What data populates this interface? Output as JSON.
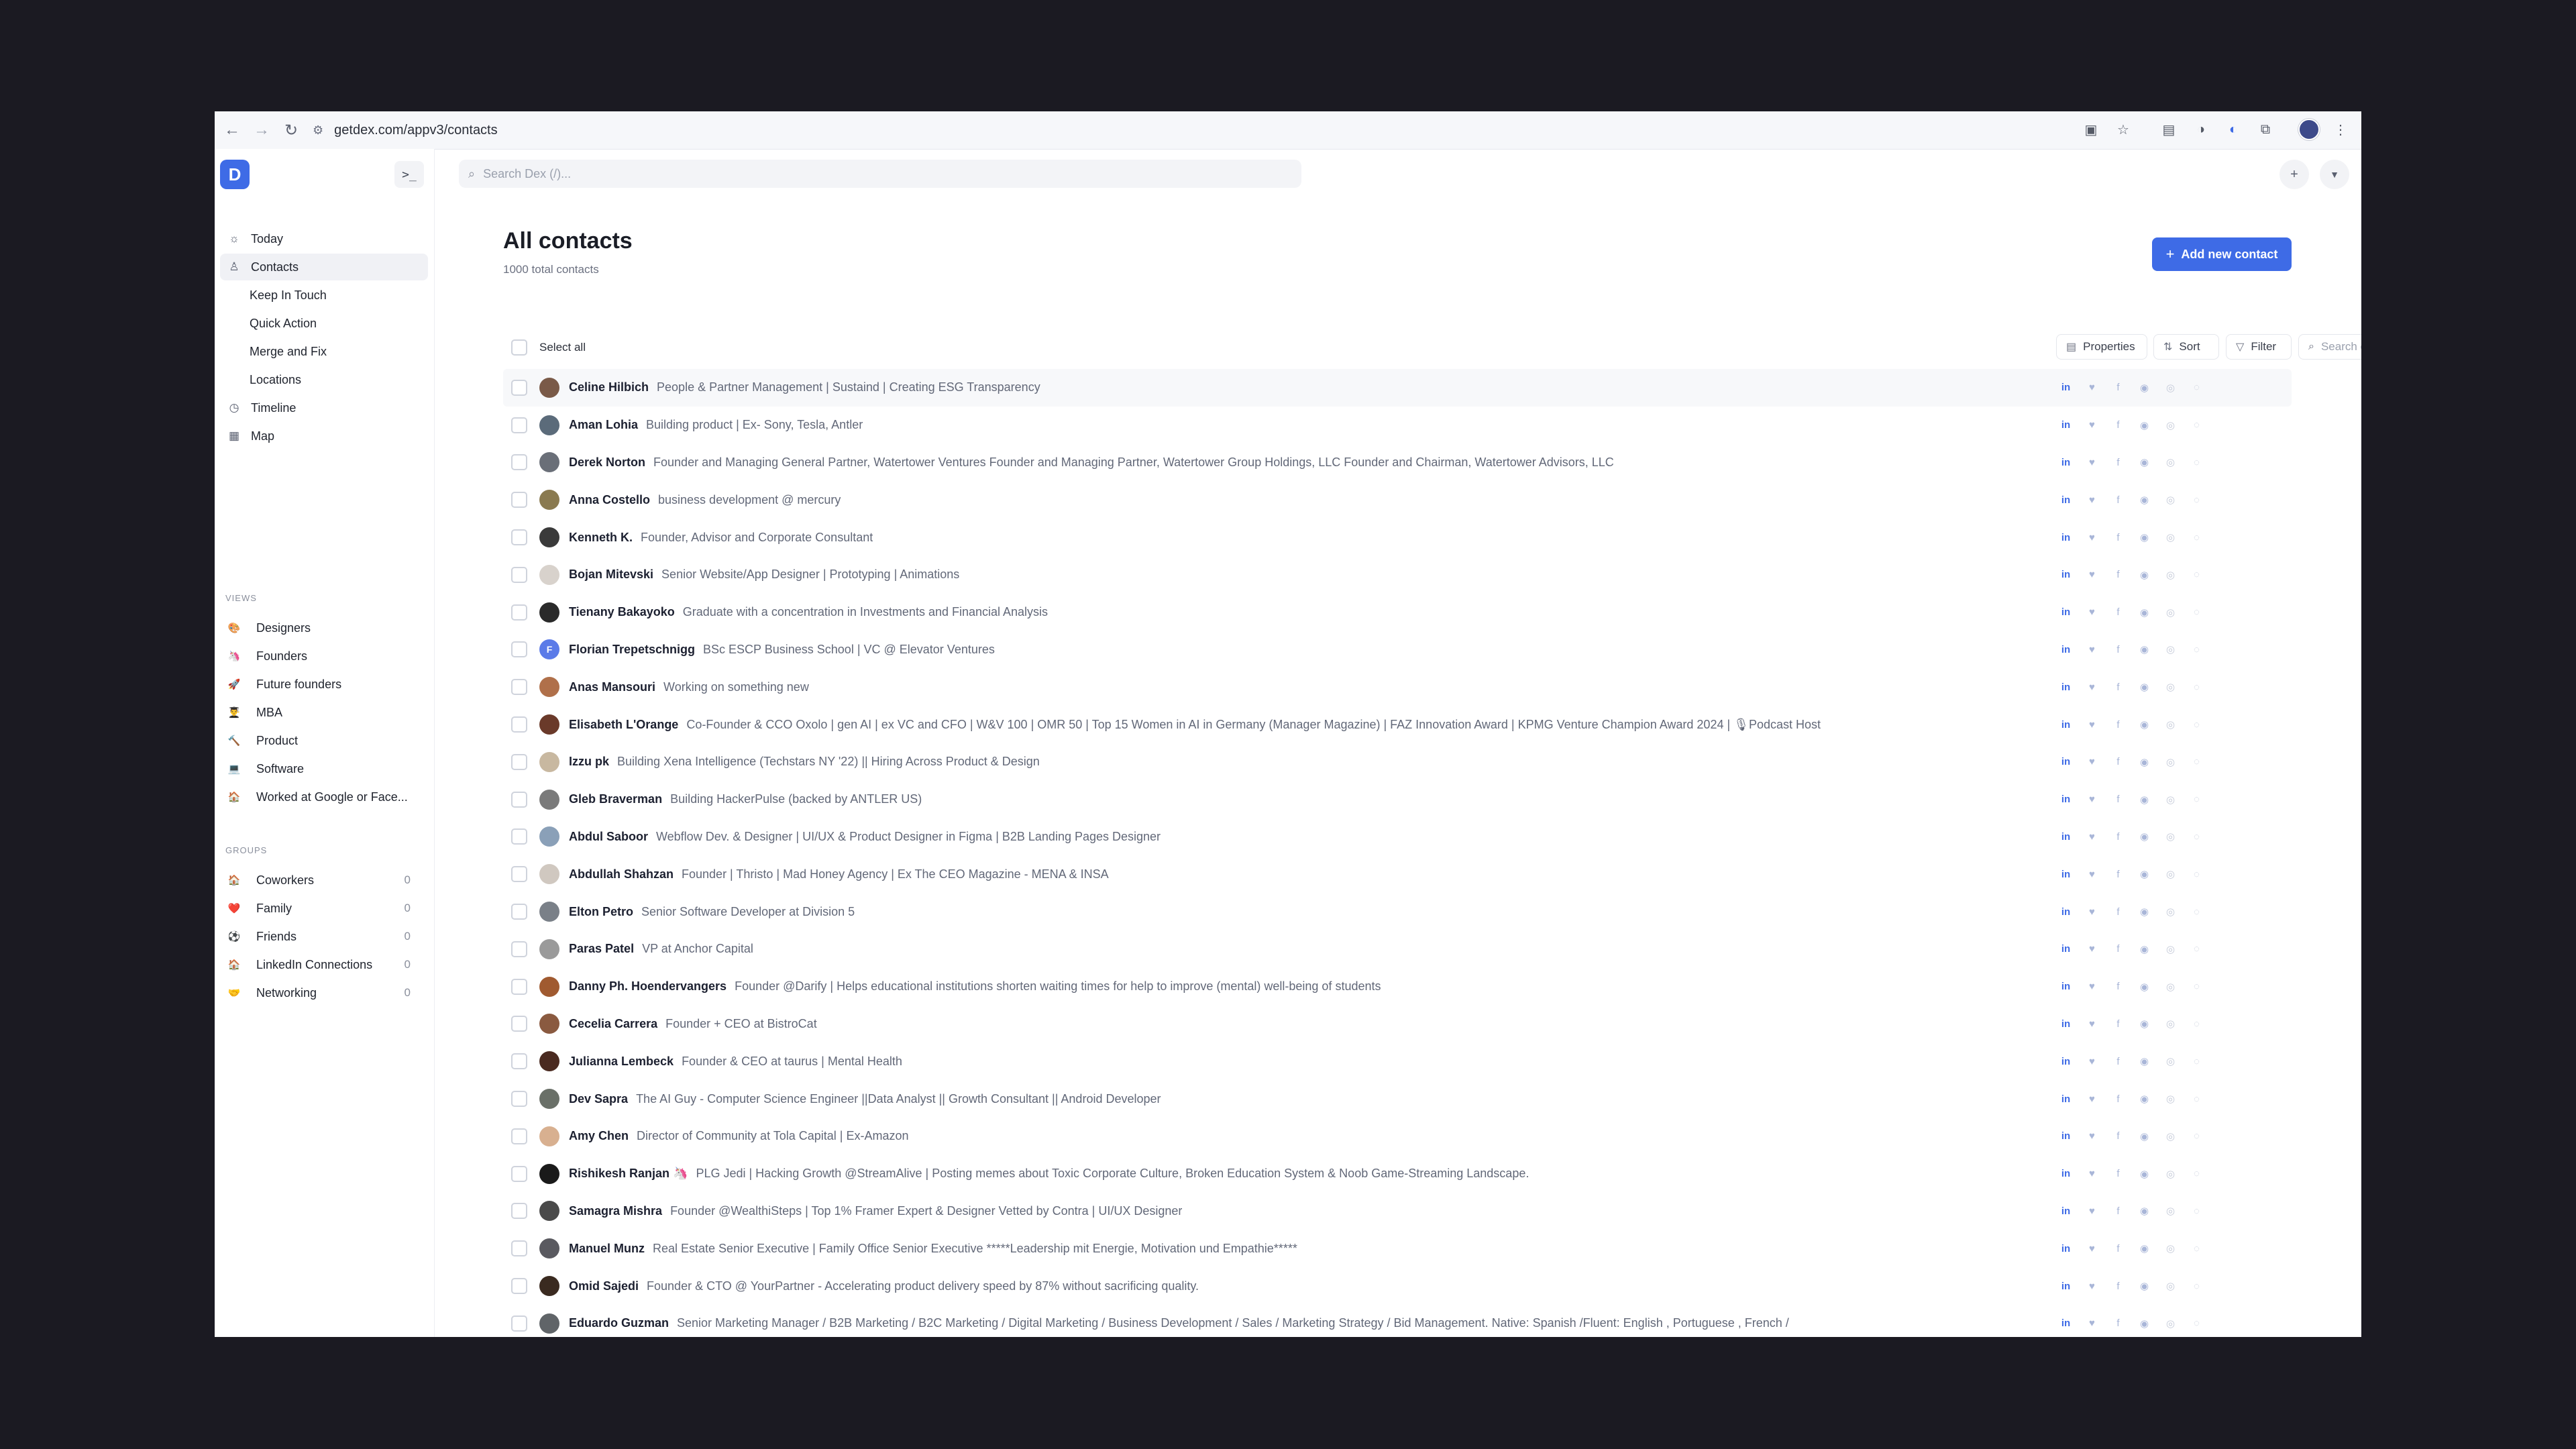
{
  "browser": {
    "url": "getdex.com/appv3/contacts"
  },
  "search": {
    "placeholder": "Search Dex (/)..."
  },
  "sidebar": {
    "logo": "D",
    "nav": [
      {
        "label": "Today",
        "icon": "sun-icon",
        "glyph": "☼"
      },
      {
        "label": "Contacts",
        "icon": "user-icon",
        "glyph": "♙",
        "active": true
      },
      {
        "label": "Keep In Touch",
        "sub": true
      },
      {
        "label": "Quick Action",
        "sub": true
      },
      {
        "label": "Merge and Fix",
        "sub": true
      },
      {
        "label": "Locations",
        "sub": true
      },
      {
        "label": "Timeline",
        "icon": "clock-icon",
        "glyph": "◷"
      },
      {
        "label": "Map",
        "icon": "map-icon",
        "glyph": "▦"
      }
    ],
    "views_label": "VIEWS",
    "views": [
      {
        "label": "Designers",
        "emoji": "🎨"
      },
      {
        "label": "Founders",
        "emoji": "🦄"
      },
      {
        "label": "Future founders",
        "emoji": "🚀"
      },
      {
        "label": "MBA",
        "emoji": "👨‍🎓"
      },
      {
        "label": "Product",
        "emoji": "🔨"
      },
      {
        "label": "Software",
        "emoji": "💻"
      },
      {
        "label": "Worked at Google or Face...",
        "emoji": "🏠"
      }
    ],
    "groups_label": "GROUPS",
    "groups": [
      {
        "label": "Coworkers",
        "emoji": "🏠",
        "count": "0"
      },
      {
        "label": "Family",
        "emoji": "❤️",
        "count": "0"
      },
      {
        "label": "Friends",
        "emoji": "⚽",
        "count": "0"
      },
      {
        "label": "LinkedIn Connections",
        "emoji": "🏠",
        "count": "0"
      },
      {
        "label": "Networking",
        "emoji": "🤝",
        "count": "0"
      }
    ]
  },
  "main": {
    "title": "All contacts",
    "subtitle": "1000 total contacts",
    "add_button": "Add new contact",
    "select_all": "Select all",
    "properties": "Properties",
    "sort": "Sort",
    "filter": "Filter",
    "search_contacts_placeholder": "Search contacts..."
  },
  "contacts": [
    {
      "name": "Celine Hilbich",
      "headline": "People & Partner Management | Sustaind | Creating ESG Transparency",
      "avatar_color": "#7a5a48",
      "initial": ""
    },
    {
      "name": "Aman Lohia",
      "headline": "Building product | Ex- Sony, Tesla, Antler",
      "avatar_color": "#5b6b7a",
      "initial": ""
    },
    {
      "name": "Derek Norton",
      "headline": "Founder and Managing General Partner, Watertower Ventures Founder and Managing Partner, Watertower Group Holdings, LLC Founder and Chairman, Watertower Advisors, LLC",
      "avatar_color": "#6a6f78",
      "initial": ""
    },
    {
      "name": "Anna Costello",
      "headline": "business development @ mercury",
      "avatar_color": "#8a7a50",
      "initial": ""
    },
    {
      "name": "Kenneth K.",
      "headline": "Founder, Advisor and Corporate Consultant",
      "avatar_color": "#3a3a3a",
      "initial": ""
    },
    {
      "name": "Bojan Mitevski",
      "headline": "Senior Website/App Designer | Prototyping | Animations",
      "avatar_color": "#d8d2cc",
      "initial": ""
    },
    {
      "name": "Tienany Bakayoko",
      "headline": "Graduate with a concentration in Investments and Financial Analysis",
      "avatar_color": "#2a2a2a",
      "initial": ""
    },
    {
      "name": "Florian Trepetschnigg",
      "headline": "BSc ESCP Business School | VC @ Elevator Ventures",
      "avatar_color": "#5b7be8",
      "initial": "F"
    },
    {
      "name": "Anas Mansouri",
      "headline": "Working on something new",
      "avatar_color": "#b0704a",
      "initial": ""
    },
    {
      "name": "Elisabeth L'Orange",
      "headline": "Co-Founder & CCO Oxolo | gen AI | ex VC and CFO | W&V 100 | OMR 50 | Top 15 Women in AI in Germany (Manager Magazine) | FAZ Innovation Award | KPMG Venture Champion Award 2024 | 🎙Podcast Host",
      "avatar_color": "#6a3a2a",
      "initial": ""
    },
    {
      "name": "Izzu pk",
      "headline": "Building Xena Intelligence (Techstars NY '22) || Hiring Across Product & Design",
      "avatar_color": "#c8b8a0",
      "initial": ""
    },
    {
      "name": "Gleb Braverman",
      "headline": "Building HackerPulse (backed by ANTLER US)",
      "avatar_color": "#7a7a7a",
      "initial": ""
    },
    {
      "name": "Abdul Saboor",
      "headline": "Webflow Dev. & Designer | UI/UX & Product Designer in Figma | B2B Landing Pages Designer",
      "avatar_color": "#8aa0b8",
      "initial": ""
    },
    {
      "name": "Abdullah Shahzan",
      "headline": "Founder | Thristo | Mad Honey Agency | Ex The CEO Magazine - MENA & INSA",
      "avatar_color": "#d0c8c0",
      "initial": ""
    },
    {
      "name": "Elton Petro",
      "headline": "Senior Software Developer at Division 5",
      "avatar_color": "#7a8088",
      "initial": ""
    },
    {
      "name": "Paras Patel",
      "headline": "VP at Anchor Capital",
      "avatar_color": "#9a9a9a",
      "initial": ""
    },
    {
      "name": "Danny Ph. Hoendervangers",
      "headline": "Founder @Darify | Helps educational institutions shorten waiting times for help to improve (mental) well-being of students",
      "avatar_color": "#a05a30",
      "initial": ""
    },
    {
      "name": "Cecelia Carrera",
      "headline": "Founder + CEO at BistroCat",
      "avatar_color": "#8a5a40",
      "initial": ""
    },
    {
      "name": "Julianna Lembeck",
      "headline": "Founder & CEO at taurus | Mental Health",
      "avatar_color": "#4a2a20",
      "initial": ""
    },
    {
      "name": "Dev Sapra",
      "headline": "The AI Guy - Computer Science Engineer ||Data Analyst || Growth Consultant || Android Developer",
      "avatar_color": "#6a7068",
      "initial": ""
    },
    {
      "name": "Amy Chen",
      "headline": "Director of Community at Tola Capital | Ex-Amazon",
      "avatar_color": "#d8b090",
      "initial": ""
    },
    {
      "name": "Rishikesh Ranjan 🦄",
      "headline": "PLG Jedi | Hacking Growth @StreamAlive | Posting memes about Toxic Corporate Culture, Broken Education System & Noob Game-Streaming Landscape.",
      "avatar_color": "#1a1a1a",
      "initial": ""
    },
    {
      "name": "Samagra Mishra",
      "headline": "Founder @WealthiSteps | Top 1% Framer Expert & Designer Vetted by Contra | UI/UX Designer",
      "avatar_color": "#4a4a4a",
      "initial": ""
    },
    {
      "name": "Manuel Munz",
      "headline": "Real Estate Senior Executive | Family Office Senior Executive *****Leadership mit Energie, Motivation und Empathie*****",
      "avatar_color": "#5a5a60",
      "initial": ""
    },
    {
      "name": "Omid Sajedi",
      "headline": "Founder & CTO @ YourPartner - Accelerating product delivery speed by 87% without sacrificing quality.",
      "avatar_color": "#3a2a20",
      "initial": ""
    },
    {
      "name": "Eduardo Guzman",
      "headline": "Senior Marketing Manager / B2B Marketing / B2C Marketing / Digital Marketing / Business Development / Sales / Marketing Strategy / Bid Management. Native: Spanish /Fluent: English , Portuguese , French /",
      "avatar_color": "#606468",
      "initial": ""
    }
  ],
  "social_icons": [
    "linkedin-icon",
    "twitter-icon",
    "facebook-icon",
    "messenger-icon",
    "instagram-icon",
    "whatsapp-icon"
  ],
  "social_glyphs": {
    "linkedin": "in",
    "twitter": "♥",
    "facebook": "f",
    "messenger": "◉",
    "instagram": "◎",
    "whatsapp": "◌"
  }
}
